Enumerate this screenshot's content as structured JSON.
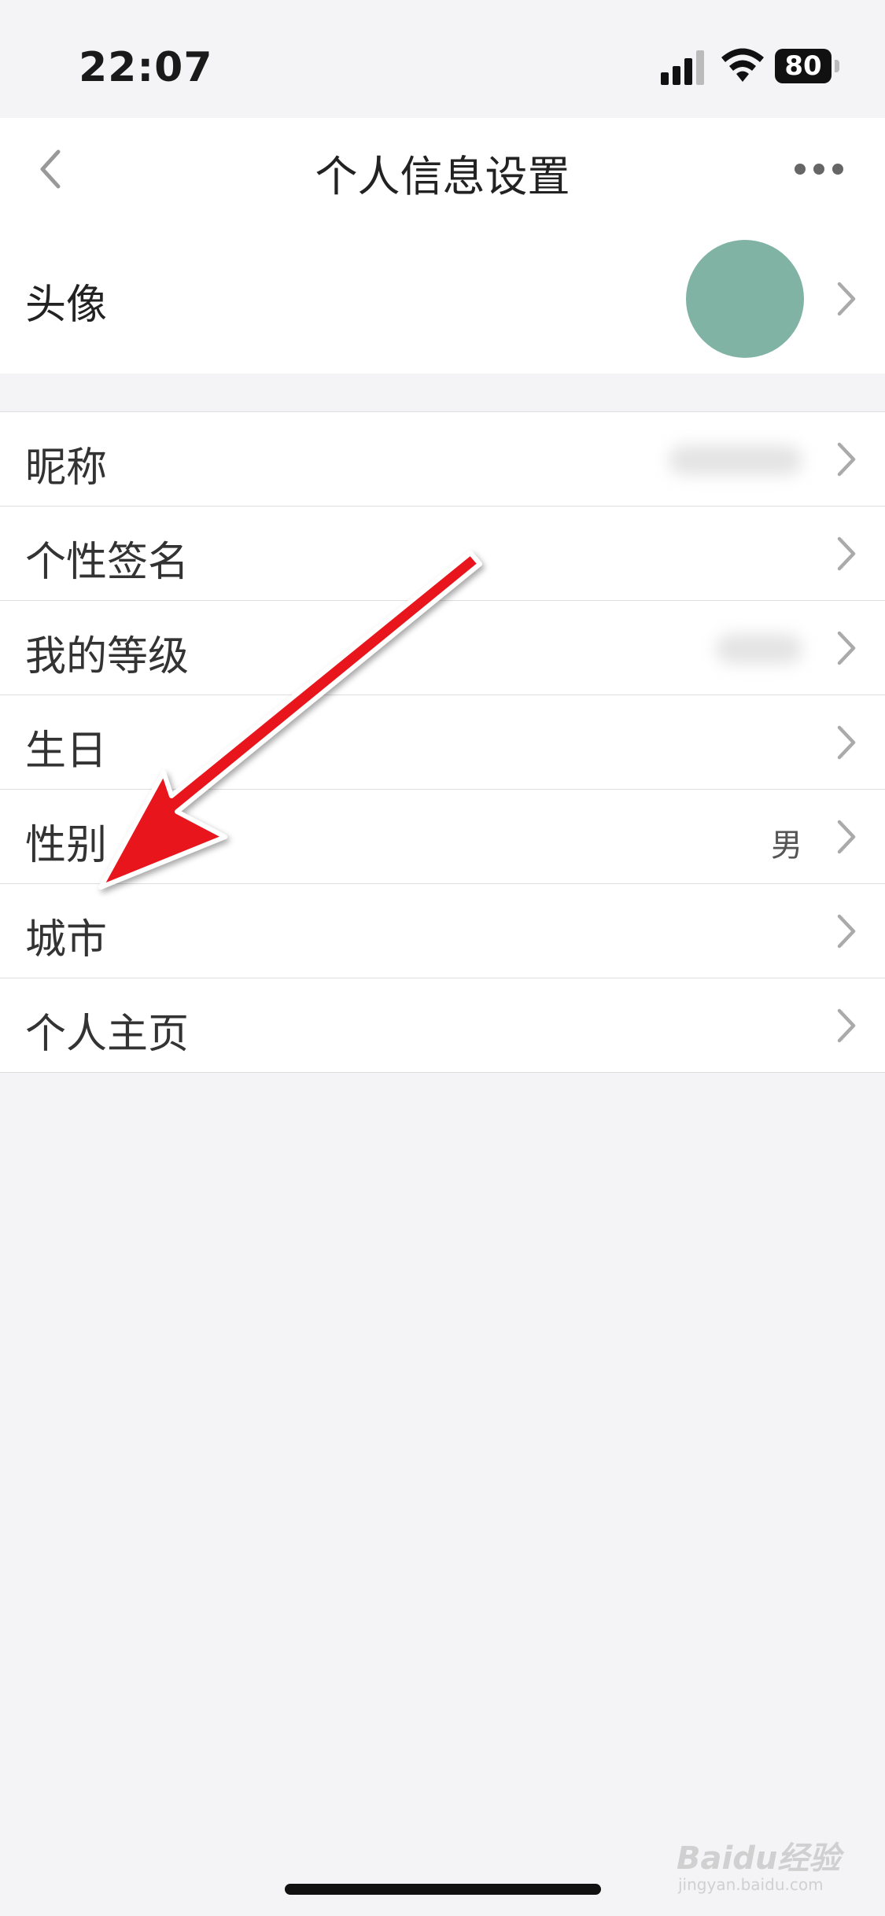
{
  "status_bar": {
    "time": "22:07",
    "battery": "80"
  },
  "nav": {
    "title": "个人信息设置"
  },
  "avatar_row": {
    "label": "头像",
    "avatar_color": "#80b3a4"
  },
  "rows": [
    {
      "label": "昵称",
      "value": ""
    },
    {
      "label": "个性签名",
      "value": ""
    },
    {
      "label": "我的等级",
      "value": ""
    },
    {
      "label": "生日",
      "value": ""
    },
    {
      "label": "性别",
      "value": "男"
    },
    {
      "label": "城市",
      "value": ""
    },
    {
      "label": "个人主页",
      "value": ""
    }
  ],
  "annotation": {
    "arrow_color": "#e8141b"
  },
  "watermark": {
    "brand": "Baidu经验",
    "url": "jingyan.baidu.com"
  }
}
